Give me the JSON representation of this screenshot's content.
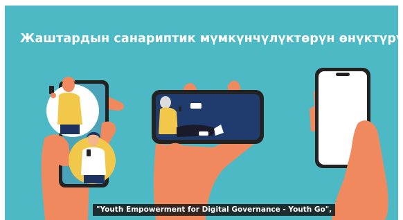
{
  "video": {
    "title": "Жаштардын санариптик мүмкүнчүлүктөрүн өнүктүрүү",
    "caption": "\"Youth Empowerment for Digital Governance - Youth Go\",",
    "colors": {
      "background": "#4cb9c5",
      "hand": "#f08a5e",
      "phone_frame": "#222222",
      "phone_screen_blue": "#203b6e",
      "avatar_circle_white": "#ffffff",
      "avatar_circle_yellow": "#f2c84b"
    },
    "illustrations": [
      "left-hand-holding-phone-with-video-call",
      "center-hand-holding-landscape-phone",
      "right-hand-holding-blank-phone"
    ]
  }
}
